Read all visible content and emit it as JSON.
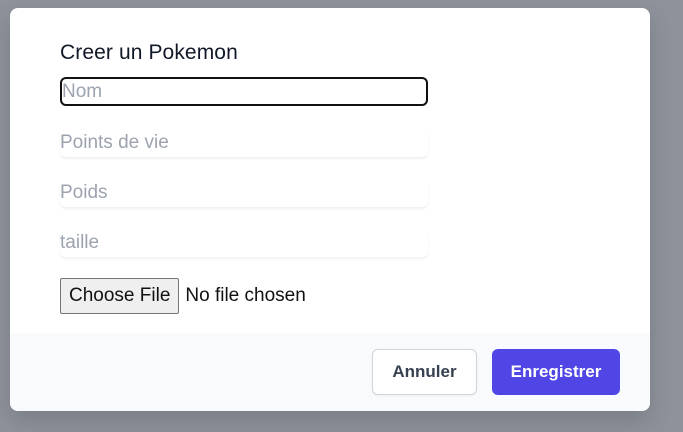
{
  "modal": {
    "title": "Creer un Pokemon",
    "fields": {
      "nom": {
        "placeholder": "Nom",
        "value": ""
      },
      "points_de_vie": {
        "placeholder": "Points de vie",
        "value": ""
      },
      "poids": {
        "placeholder": "Poids",
        "value": ""
      },
      "taille": {
        "placeholder": "taille",
        "value": ""
      }
    },
    "file": {
      "button_label": "Choose File",
      "status": "No file chosen"
    },
    "footer": {
      "cancel_label": "Annuler",
      "save_label": "Enregistrer"
    }
  },
  "colors": {
    "overlay": "#8e929b",
    "primary": "#4f46e5",
    "footer_bg": "#f9fafb"
  }
}
